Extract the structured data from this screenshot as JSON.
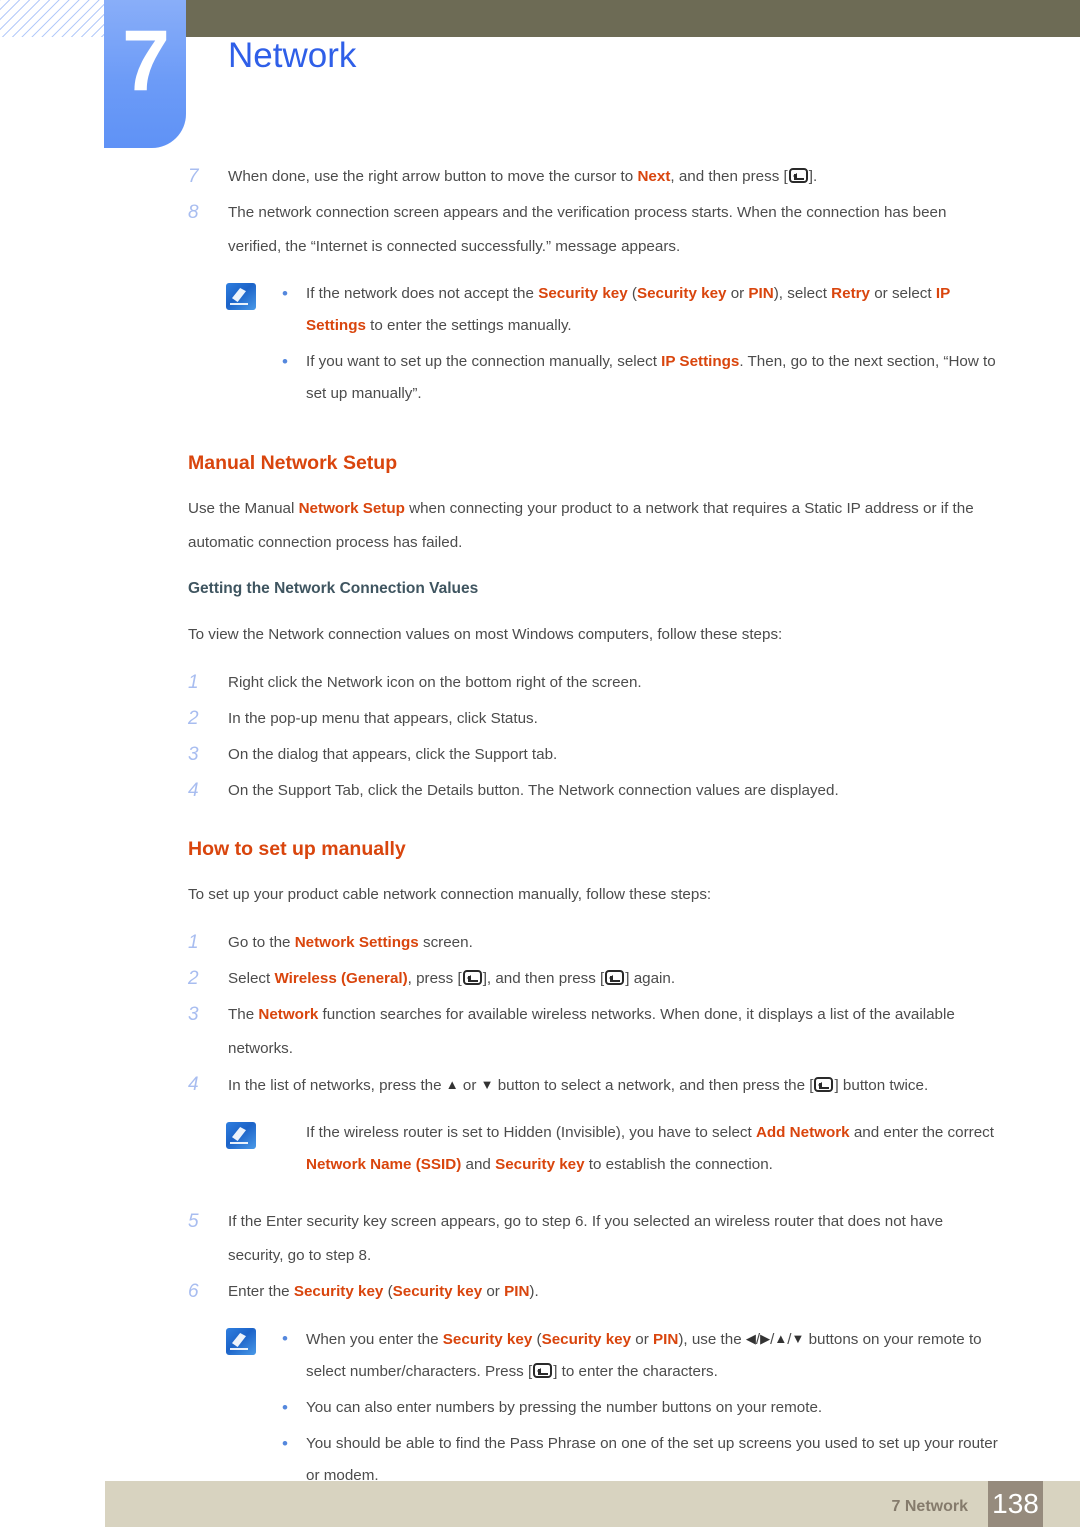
{
  "header": {
    "chapter_number": "7",
    "chapter_title": "Network"
  },
  "steps_top": [
    {
      "number": "7",
      "text_parts": [
        {
          "t": "When done, use the right arrow button to move the cursor to ",
          "s": "plain"
        },
        {
          "t": "Next",
          "s": "kw"
        },
        {
          "t": ", and then press [",
          "s": "plain"
        },
        {
          "t": "enter-key-icon",
          "s": "enter"
        },
        {
          "t": "].",
          "s": "plain"
        }
      ]
    },
    {
      "number": "8",
      "text_parts": [
        {
          "t": "The network connection screen appears and the verification process starts. When the connection has been verified, the “Internet is connected successfully.” message appears.",
          "s": "plain"
        }
      ]
    }
  ],
  "note_one": {
    "icon": "note-pencil-icon",
    "bullets": [
      [
        {
          "t": "If the network does not accept the ",
          "s": "plain"
        },
        {
          "t": "Security key",
          "s": "kw"
        },
        {
          "t": " (",
          "s": "plain"
        },
        {
          "t": "Security key",
          "s": "kw"
        },
        {
          "t": " or ",
          "s": "plain"
        },
        {
          "t": "PIN",
          "s": "kw"
        },
        {
          "t": "), select ",
          "s": "plain"
        },
        {
          "t": "Retry",
          "s": "kw"
        },
        {
          "t": " or select ",
          "s": "plain"
        },
        {
          "t": "IP Settings",
          "s": "kw"
        },
        {
          "t": " to enter the settings manually.",
          "s": "plain"
        }
      ],
      [
        {
          "t": "If you want to set up the connection manually, select ",
          "s": "plain"
        },
        {
          "t": "IP Settings",
          "s": "kw"
        },
        {
          "t": ". Then, go to the next section, “How to set up manually”.",
          "s": "plain"
        }
      ]
    ]
  },
  "section_manual": {
    "heading": "Manual Network Setup",
    "intro_parts": [
      {
        "t": "Use the Manual ",
        "s": "plain"
      },
      {
        "t": "Network Setup",
        "s": "kw"
      },
      {
        "t": " when connecting your product to a network that requires a Static IP address or if the automatic connection process has failed.",
        "s": "plain"
      }
    ],
    "sub_heading": "Getting the Network Connection Values",
    "sub_intro": "To view the Network connection values on most Windows computers, follow these steps:",
    "steps": [
      {
        "number": "1",
        "text": "Right click the Network icon on the bottom right of the screen."
      },
      {
        "number": "2",
        "text": "In the pop-up menu that appears, click Status."
      },
      {
        "number": "3",
        "text": "On the dialog that appears, click the Support tab."
      },
      {
        "number": "4",
        "text": "On the Support Tab, click the Details button. The Network connection values are displayed."
      }
    ]
  },
  "section_howto": {
    "heading": "How to set up manually",
    "intro": "To set up your product cable network connection manually, follow these steps:",
    "steps": [
      {
        "number": "1",
        "parts": [
          {
            "t": "Go to the ",
            "s": "plain"
          },
          {
            "t": "Network Settings",
            "s": "kw"
          },
          {
            "t": " screen.",
            "s": "plain"
          }
        ]
      },
      {
        "number": "2",
        "parts": [
          {
            "t": "Select ",
            "s": "plain"
          },
          {
            "t": "Wireless (General)",
            "s": "kw"
          },
          {
            "t": ", press [",
            "s": "plain"
          },
          {
            "t": "enter-key-icon",
            "s": "enter"
          },
          {
            "t": "], and then press [",
            "s": "plain"
          },
          {
            "t": "enter-key-icon",
            "s": "enter"
          },
          {
            "t": "] again.",
            "s": "plain"
          }
        ]
      },
      {
        "number": "3",
        "parts": [
          {
            "t": "The ",
            "s": "plain"
          },
          {
            "t": "Network",
            "s": "kw"
          },
          {
            "t": " function searches for available wireless networks. When done, it displays a list of the available networks.",
            "s": "plain"
          }
        ]
      },
      {
        "number": "4",
        "parts": [
          {
            "t": "In the list of networks, press the ",
            "s": "plain"
          },
          {
            "t": "▲",
            "s": "arrow"
          },
          {
            "t": " or ",
            "s": "plain"
          },
          {
            "t": "▼",
            "s": "arrow"
          },
          {
            "t": " button to select a network, and then press the [",
            "s": "plain"
          },
          {
            "t": "enter-key-icon",
            "s": "enter"
          },
          {
            "t": "] button twice.",
            "s": "plain"
          }
        ]
      }
    ],
    "steps_after": [
      {
        "number": "5",
        "parts": [
          {
            "t": "If the Enter security key screen appears, go to step 6. If you selected an wireless router that does not have security, go to step 8.",
            "s": "plain"
          }
        ]
      },
      {
        "number": "6",
        "parts": [
          {
            "t": "Enter the ",
            "s": "plain"
          },
          {
            "t": "Security key",
            "s": "kw"
          },
          {
            "t": " (",
            "s": "plain"
          },
          {
            "t": "Security key",
            "s": "kw"
          },
          {
            "t": " or ",
            "s": "plain"
          },
          {
            "t": "PIN",
            "s": "kw"
          },
          {
            "t": ").",
            "s": "plain"
          }
        ]
      }
    ]
  },
  "note_two": {
    "icon": "note-pencil-icon",
    "parts": [
      {
        "t": "If the wireless router is set to Hidden (Invisible), you have to select ",
        "s": "plain"
      },
      {
        "t": "Add Network",
        "s": "kw"
      },
      {
        "t": " and enter the correct ",
        "s": "plain"
      },
      {
        "t": "Network Name (SSID)",
        "s": "kw"
      },
      {
        "t": " and ",
        "s": "plain"
      },
      {
        "t": "Security key",
        "s": "kw"
      },
      {
        "t": " to establish the connection.",
        "s": "plain"
      }
    ]
  },
  "note_three": {
    "icon": "note-pencil-icon",
    "bullets": [
      [
        {
          "t": "When you enter the ",
          "s": "plain"
        },
        {
          "t": "Security key",
          "s": "kw"
        },
        {
          "t": " (",
          "s": "plain"
        },
        {
          "t": "Security key",
          "s": "kw"
        },
        {
          "t": " or ",
          "s": "plain"
        },
        {
          "t": "PIN",
          "s": "kw"
        },
        {
          "t": "), use the ",
          "s": "plain"
        },
        {
          "t": "◀",
          "s": "arrow"
        },
        {
          "t": "/",
          "s": "plain"
        },
        {
          "t": "▶",
          "s": "arrow"
        },
        {
          "t": "/",
          "s": "plain"
        },
        {
          "t": "▲",
          "s": "arrow"
        },
        {
          "t": "/",
          "s": "plain"
        },
        {
          "t": "▼",
          "s": "arrow"
        },
        {
          "t": " buttons on your remote to select number/characters. Press [",
          "s": "plain"
        },
        {
          "t": "enter-key-icon",
          "s": "enter"
        },
        {
          "t": "] to enter the characters.",
          "s": "plain"
        }
      ],
      [
        {
          "t": "You can also enter numbers by pressing the number buttons on your remote.",
          "s": "plain"
        }
      ],
      [
        {
          "t": "You should be able to find the Pass Phrase on one of the set up screens you used to set up your router or modem.",
          "s": "plain"
        }
      ]
    ]
  },
  "footer": {
    "label": "7 Network",
    "page_number": "138"
  },
  "colors": {
    "keyword": "#d9450d",
    "heading_major": "#d9450d",
    "heading_minor": "#3f5560",
    "step_number": "#a8bdf0",
    "chapter_blue": "#5f92f6",
    "chapter_title": "#2f5fe8",
    "olive_bar": "#6d6b55",
    "footer_bar": "#d8d3c0",
    "footer_page_box": "#968b7d",
    "body_text": "#4c4c4c"
  }
}
